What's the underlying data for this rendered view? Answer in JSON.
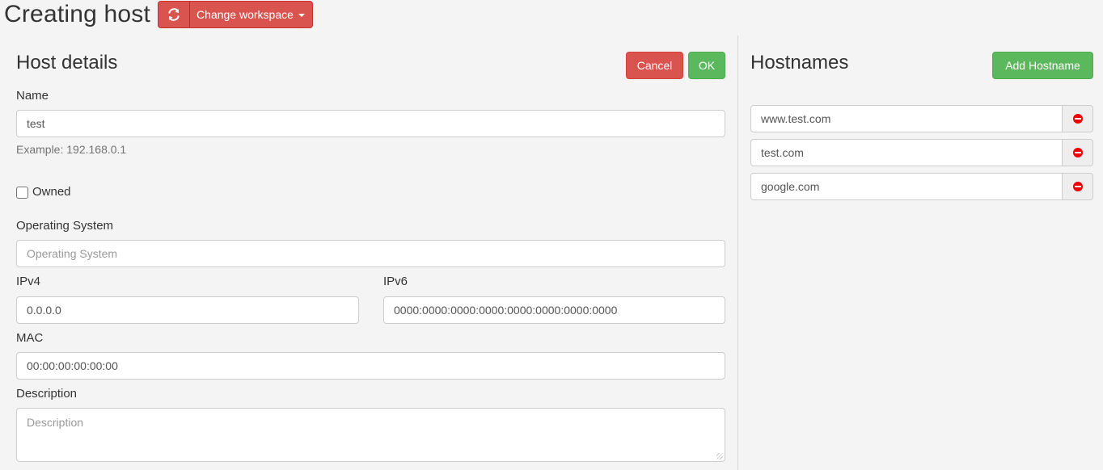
{
  "page": {
    "title": "Creating host",
    "workspace_button_label": "Change workspace"
  },
  "host_details": {
    "title": "Host details",
    "cancel_label": "Cancel",
    "ok_label": "OK",
    "name_label": "Name",
    "name_value": "test",
    "name_help": "Example: 192.168.0.1",
    "owned_label": "Owned",
    "owned_checked": false,
    "os_label": "Operating System",
    "os_placeholder": "Operating System",
    "ipv4_label": "IPv4",
    "ipv4_value": "0.0.0.0",
    "ipv6_label": "IPv6",
    "ipv6_value": "0000:0000:0000:0000:0000:0000:0000:0000",
    "mac_label": "MAC",
    "mac_value": "00:00:00:00:00:00",
    "description_label": "Description",
    "description_placeholder": "Description"
  },
  "hostnames": {
    "title": "Hostnames",
    "add_label": "Add Hostname",
    "items": [
      {
        "value": "www.test.com"
      },
      {
        "value": "test.com"
      },
      {
        "value": "google.com"
      }
    ]
  },
  "colors": {
    "danger": "#d9534f",
    "success": "#5cb85c",
    "remove_icon": "#ee0000"
  },
  "icons": {
    "refresh": "refresh-icon",
    "remove": "minus-circle-icon",
    "dropdown": "caret-down-icon"
  }
}
